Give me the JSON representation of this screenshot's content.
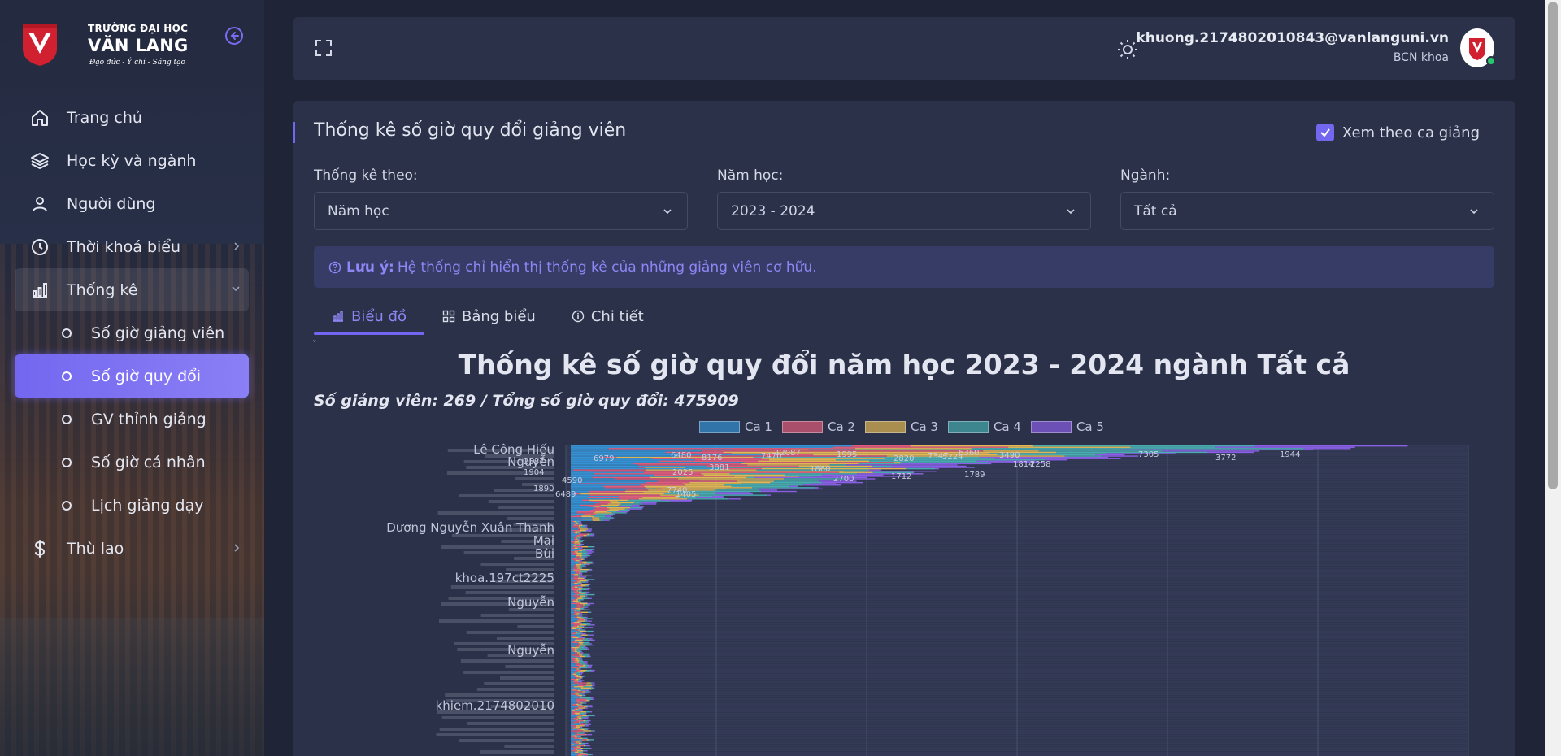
{
  "brand": {
    "line1": "TRƯỜNG ĐẠI HỌC",
    "line2": "VĂN LANG",
    "slogan": "Đạo đức - Ý chí - Sáng tạo",
    "color": "#d1202f"
  },
  "sidebar": {
    "items": [
      {
        "label": "Trang chủ",
        "icon": "home-icon"
      },
      {
        "label": "Học kỳ và ngành",
        "icon": "layers-icon"
      },
      {
        "label": "Người dùng",
        "icon": "user-icon"
      },
      {
        "label": "Thời khoá biểu",
        "icon": "clock-icon"
      },
      {
        "label": "Thống kê",
        "icon": "bar-chart-icon"
      },
      {
        "label": "Thù lao",
        "icon": "dollar-icon"
      }
    ],
    "sub_items": [
      {
        "label": "Số giờ giảng viên"
      },
      {
        "label": "Số giờ quy đổi"
      },
      {
        "label": "GV thỉnh giảng"
      },
      {
        "label": "Số giờ cá nhân"
      },
      {
        "label": "Lịch giảng dạy"
      }
    ]
  },
  "header": {
    "email": "khuong.2174802010843@vanlanguni.vn",
    "role": "BCN khoa"
  },
  "page": {
    "title": "Thống kê số giờ quy đổi giảng viên",
    "checkbox_label": "Xem theo ca giảng",
    "checkbox_checked": true,
    "filters": [
      {
        "label": "Thống kê theo:",
        "value": "Năm học"
      },
      {
        "label": "Năm học:",
        "value": "2023 - 2024"
      },
      {
        "label": "Ngành:",
        "value": "Tất cả"
      }
    ],
    "notice_prefix": "Lưu ý:",
    "notice_text": "Hệ thống chỉ hiển thị thống kê của những giảng viên cơ hữu.",
    "tabs": [
      "Biểu đồ",
      "Bảng biểu",
      "Chi tiết"
    ],
    "active_tab": "Biểu đồ",
    "mini_mark": "ˇ"
  },
  "chart_data": {
    "type": "bar",
    "orientation": "horizontal",
    "stacked": true,
    "title": "Thống kê số giờ quy đổi năm học 2023 - 2024 ngành Tất cả",
    "subtitle": "Số giảng viên: 269 / Tổng số giờ quy đổi: 475909",
    "legend_position": "top",
    "grid": true,
    "series": [
      {
        "name": "Ca 1",
        "color": "#36a2eb"
      },
      {
        "name": "Ca 2",
        "color": "#ff6384"
      },
      {
        "name": "Ca 3",
        "color": "#ffcd56"
      },
      {
        "name": "Ca 4",
        "color": "#4bc0c0"
      },
      {
        "name": "Ca 5",
        "color": "#9966ff"
      }
    ],
    "visible_category_labels": [
      "Lê Công Hiếu",
      "Nguyễn",
      "Dương Nguyễn Xuân Thanh",
      "Mai",
      "Bùi",
      "khoa.197ct2225",
      "Nguyễn",
      "Nguyễn",
      "khiem.2174802010"
    ],
    "visible_value_labels": [
      "8176",
      "12087",
      "1995",
      "7347",
      "6360",
      "7305",
      "3772",
      "1944",
      "6979",
      "2587",
      "6480",
      "3881",
      "7470",
      "2820",
      "3490",
      "5224",
      "1904",
      "2025",
      "1860",
      "1814",
      "2258",
      "1789",
      "4590",
      "2700",
      "1712",
      "1890",
      "7740",
      "1405",
      "6489"
    ]
  },
  "colors": {
    "accent": "#7367f0",
    "card": "#2a3148",
    "background": "#1f2437"
  }
}
